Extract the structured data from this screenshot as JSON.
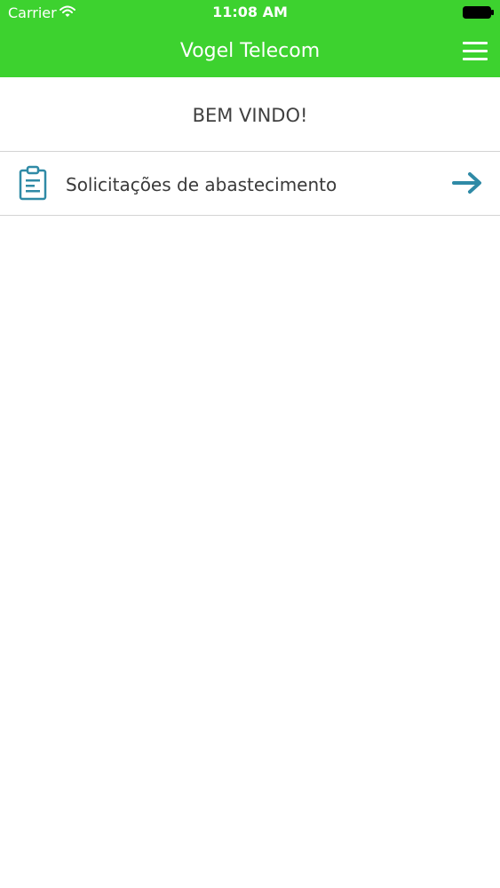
{
  "status_bar": {
    "carrier": "Carrier",
    "time": "11:08 AM"
  },
  "header": {
    "title": "Vogel Telecom",
    "background_color": "#3dd22f",
    "menu_icon": "hamburger-menu-icon"
  },
  "welcome": {
    "text": "BEM VINDO!"
  },
  "menu_items": [
    {
      "label": "Solicitações de abastecimento",
      "icon": "clipboard-icon",
      "action_icon": "arrow-right-icon",
      "accent_color": "#2f8aa6"
    }
  ]
}
